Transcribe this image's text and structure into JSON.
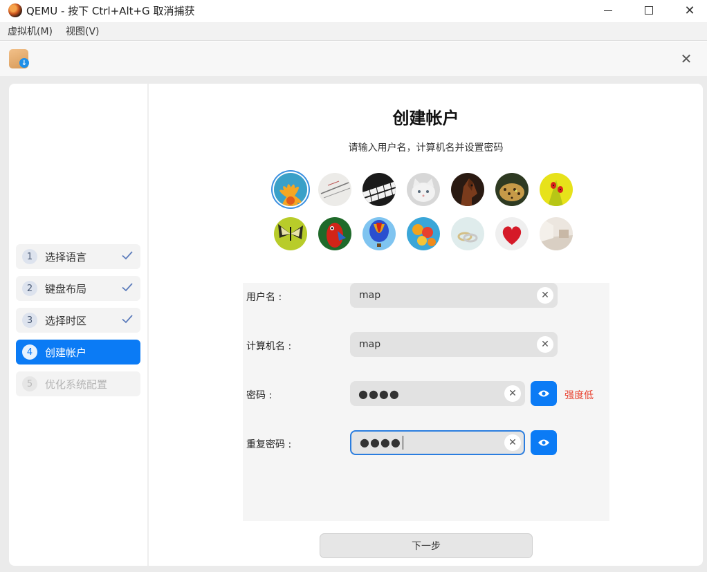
{
  "window": {
    "title": "QEMU - 按下 Ctrl+Alt+G 取消捕获",
    "menu": [
      "虚拟机(M)",
      "视图(V)"
    ]
  },
  "installer": {
    "icon": "installer-download-icon",
    "steps": [
      {
        "num": "1",
        "label": "选择语言",
        "state": "done"
      },
      {
        "num": "2",
        "label": "键盘布局",
        "state": "done"
      },
      {
        "num": "3",
        "label": "选择时区",
        "state": "done"
      },
      {
        "num": "4",
        "label": "创建帐户",
        "state": "active"
      },
      {
        "num": "5",
        "label": "优化系统配置",
        "state": "disabled"
      }
    ],
    "page": {
      "title": "创建帐户",
      "subtitle": "请输入用户名，计算机名并设置密码",
      "avatars": [
        "flower",
        "notebook",
        "piano",
        "kitten",
        "horse",
        "leopard",
        "ladybug",
        "butterfly",
        "parrot",
        "hot-air-balloon",
        "balloons",
        "rings",
        "heart",
        "room"
      ],
      "selected_avatar": "flower",
      "fields": {
        "username": {
          "label": "用户名 :",
          "value": "map"
        },
        "hostname": {
          "label": "计算机名 :",
          "value": "map"
        },
        "password": {
          "label": "密码 :",
          "value": "●●●●",
          "strength": "强度低"
        },
        "repeat_password": {
          "label": "重复密码 :",
          "value": "●●●●"
        }
      },
      "next_label": "下一步"
    }
  },
  "colors": {
    "accent": "#0b7bf5",
    "weak": "#e8402e"
  }
}
